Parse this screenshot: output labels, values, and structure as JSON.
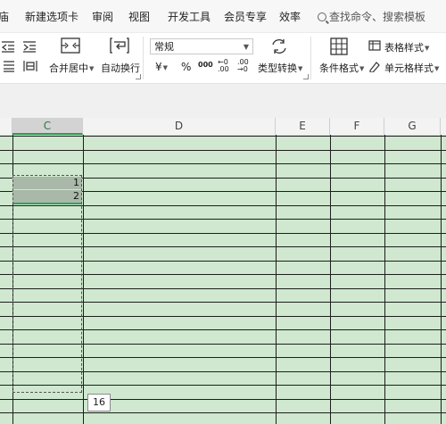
{
  "menu": {
    "tabs": [
      "庙",
      "新建选项卡",
      "审阅",
      "视图",
      "开发工具",
      "会员专享",
      "效率"
    ],
    "search_label": "查找命令、搜索模板"
  },
  "ribbon": {
    "merge_label": "合并居中",
    "wrap_label": "自动换行",
    "format_select_value": "常规",
    "currency_glyph": "¥",
    "percent_glyph": "%",
    "thousands_glyph": "000",
    "inc_decimal_glyph": "←0 .00",
    "dec_decimal_glyph": ".00 →0",
    "convert_label": "类型转换",
    "cond_format_label": "条件格式",
    "table_style_label": "表格样式",
    "cell_style_label": "单元格样式"
  },
  "columns": [
    {
      "name": "C",
      "selected": true
    },
    {
      "name": "D",
      "selected": false
    },
    {
      "name": "E",
      "selected": false
    },
    {
      "name": "F",
      "selected": false
    },
    {
      "name": "G",
      "selected": false
    }
  ],
  "cells": {
    "c1": "1",
    "c2": "2"
  },
  "selection_count": "16",
  "colors": {
    "sheet_fill": "#cfe8cf",
    "selected_cell": "#a9b8a9",
    "accent_green": "#2fa35a"
  }
}
